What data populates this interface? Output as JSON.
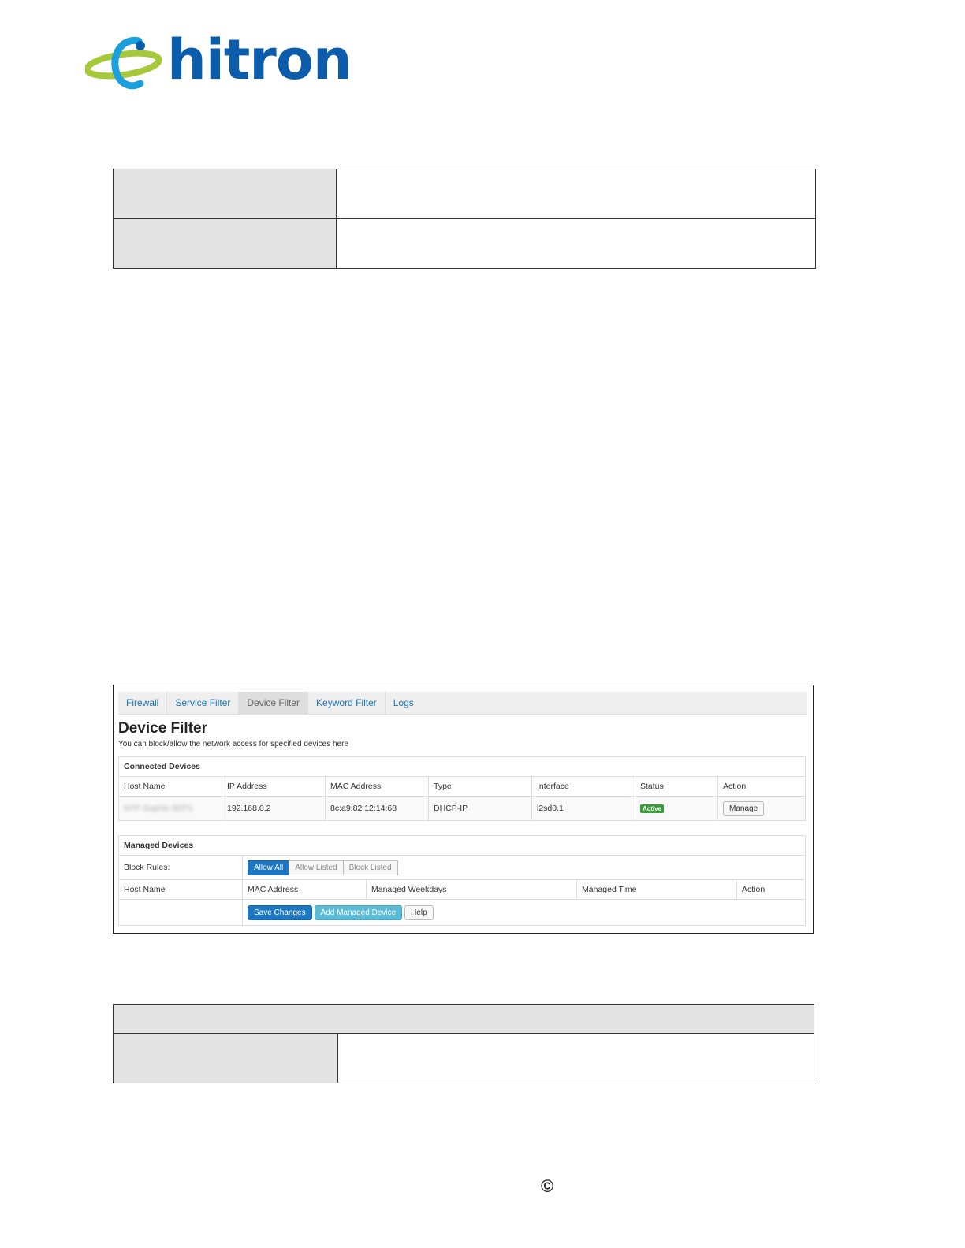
{
  "brand": {
    "name": "hitron",
    "primary_color": "#0b5cab",
    "swoosh_color": "#a6c83b"
  },
  "screenshot": {
    "tabs": [
      "Firewall",
      "Service Filter",
      "Device Filter",
      "Keyword Filter",
      "Logs"
    ],
    "active_tab": "Device Filter",
    "title": "Device Filter",
    "subtitle": "You can block/allow the network access for specified devices here",
    "connected": {
      "heading": "Connected Devices",
      "columns": [
        "Host Name",
        "IP Address",
        "MAC Address",
        "Type",
        "Interface",
        "Status",
        "Action"
      ],
      "row": {
        "host": "NYF-Sophie-SEP1",
        "ip": "192.168.0.2",
        "mac": "8c:a9:82:12:14:68",
        "type": "DHCP-IP",
        "interface": "l2sd0.1",
        "status": "Active",
        "action": "Manage"
      }
    },
    "managed": {
      "heading": "Managed Devices",
      "block_rules_label": "Block Rules:",
      "block_options": [
        "Allow All",
        "Allow Listed",
        "Block Listed"
      ],
      "selected_option": "Allow All",
      "columns": [
        "Host Name",
        "MAC Address",
        "Managed Weekdays",
        "Managed Time",
        "Action"
      ],
      "buttons": {
        "save": "Save Changes",
        "add": "Add Managed Device",
        "help": "Help"
      }
    },
    "status_color": "#3a9b3a",
    "link_color": "#1b75bb"
  },
  "footer": {
    "symbol": "©"
  }
}
